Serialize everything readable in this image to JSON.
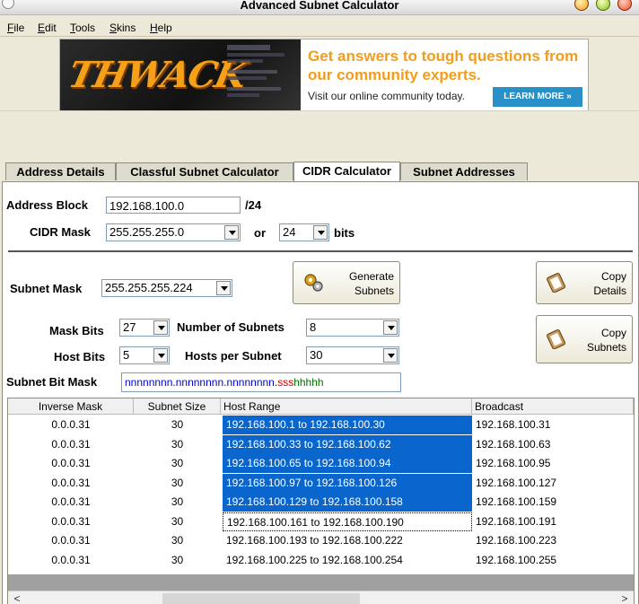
{
  "window": {
    "title": "Advanced Subnet Calculator"
  },
  "menu": [
    "File",
    "Edit",
    "Tools",
    "Skins",
    "Help"
  ],
  "banner": {
    "logo": "THWACK",
    "headline": "Get answers to tough questions from our community experts.",
    "subtext": "Visit our online community today.",
    "cta": "LEARN MORE »"
  },
  "tabs": [
    {
      "label": "Address Details",
      "active": false
    },
    {
      "label": "Classful Subnet Calculator",
      "active": false
    },
    {
      "label": "CIDR Calculator",
      "active": true
    },
    {
      "label": "Subnet Addresses",
      "active": false
    }
  ],
  "form": {
    "address_block_label": "Address Block",
    "address_block_value": "192.168.100.0",
    "prefix": "/24",
    "cidr_mask_label": "CIDR Mask",
    "cidr_mask_value": "255.255.255.0",
    "or_label": "or",
    "cidr_bits_value": "24",
    "bits_label": "bits",
    "subnet_mask_label": "Subnet Mask",
    "subnet_mask_value": "255.255.255.224",
    "mask_bits_label": "Mask Bits",
    "mask_bits_value": "27",
    "num_subnets_label": "Number of Subnets",
    "num_subnets_value": "8",
    "host_bits_label": "Host Bits",
    "host_bits_value": "5",
    "hosts_per_subnet_label": "Hosts per Subnet",
    "hosts_per_subnet_value": "30",
    "subnet_bit_mask_label": "Subnet Bit Mask",
    "bit_mask_n": "nnnnnnnn.nnnnnnnn.nnnnnnnn.",
    "bit_mask_s": "sss",
    "bit_mask_h": "hhhhh"
  },
  "buttons": {
    "generate_line1": "Generate",
    "generate_line2": "Subnets",
    "copy_details_line1": "Copy",
    "copy_details_line2": "Details",
    "copy_subnets_line1": "Copy",
    "copy_subnets_line2": "Subnets"
  },
  "table": {
    "columns": [
      "Inverse Mask",
      "Subnet Size",
      "Host Range",
      "Broadcast"
    ],
    "rows": [
      {
        "inverse": "0.0.0.31",
        "size": "30",
        "range": "192.168.100.1  to  192.168.100.30",
        "broadcast": "192.168.100.31",
        "selected": true
      },
      {
        "inverse": "0.0.0.31",
        "size": "30",
        "range": "192.168.100.33  to  192.168.100.62",
        "broadcast": "192.168.100.63",
        "selected": true
      },
      {
        "inverse": "0.0.0.31",
        "size": "30",
        "range": "192.168.100.65  to  192.168.100.94",
        "broadcast": "192.168.100.95",
        "selected": true
      },
      {
        "inverse": "0.0.0.31",
        "size": "30",
        "range": "192.168.100.97  to  192.168.100.126",
        "broadcast": "192.168.100.127",
        "selected": true
      },
      {
        "inverse": "0.0.0.31",
        "size": "30",
        "range": "192.168.100.129  to  192.168.100.158",
        "broadcast": "192.168.100.159",
        "selected": true
      },
      {
        "inverse": "0.0.0.31",
        "size": "30",
        "range": "192.168.100.161  to  192.168.100.190",
        "broadcast": "192.168.100.191",
        "selected": false,
        "focused": true
      },
      {
        "inverse": "0.0.0.31",
        "size": "30",
        "range": "192.168.100.193  to  192.168.100.222",
        "broadcast": "192.168.100.223",
        "selected": false
      },
      {
        "inverse": "0.0.0.31",
        "size": "30",
        "range": "192.168.100.225  to  192.168.100.254",
        "broadcast": "192.168.100.255",
        "selected": false
      }
    ]
  },
  "scrollbar": {
    "left": "<",
    "right": ">"
  },
  "colors": {
    "selection": "#0a66cc",
    "banner_accent": "#f39c1c",
    "cta": "#2a90c8"
  }
}
